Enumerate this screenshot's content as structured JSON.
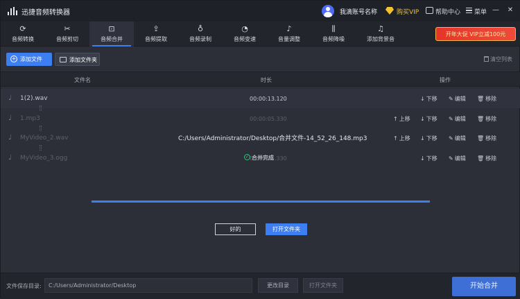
{
  "app": {
    "title": "迅捷音频转换器"
  },
  "titlebar": {
    "account": "我滴账号名称",
    "vip": "购买VIP",
    "messages": "帮助中心",
    "menu": "菜单",
    "minimize": "—",
    "close": "✕"
  },
  "toolbar": {
    "tools": [
      {
        "label": "音频转换",
        "icon": "refresh-icon"
      },
      {
        "label": "音频剪切",
        "icon": "scissors-icon"
      },
      {
        "label": "音频合并",
        "icon": "merge-icon"
      },
      {
        "label": "音频提取",
        "icon": "extract-icon"
      },
      {
        "label": "音频录制",
        "icon": "microphone-icon"
      },
      {
        "label": "音频变速",
        "icon": "speed-icon"
      },
      {
        "label": "音量调整",
        "icon": "volume-icon"
      },
      {
        "label": "音频降噪",
        "icon": "noise-reduce-icon"
      },
      {
        "label": "添加背景音",
        "icon": "music-icon"
      }
    ],
    "active_index": 2,
    "promo": "开年大促 VIP立减100元"
  },
  "actions": {
    "add_file": "添加文件",
    "add_folder": "添加文件夹",
    "clear_list": "清空列表"
  },
  "table": {
    "headers": {
      "name": "文件名",
      "duration": "时长",
      "ops": "操作"
    },
    "rows": [
      {
        "name": "1(2).wav",
        "duration": "00:00:13.120",
        "up": "",
        "down": "下移",
        "edit": "编辑",
        "remove": "移除"
      },
      {
        "name": "1.mp3",
        "duration": "00:00:05.330",
        "up": "上移",
        "down": "下移",
        "edit": "编辑",
        "remove": "移除"
      },
      {
        "name": "MyVideo_2.wav",
        "duration": "",
        "up": "上移",
        "down": "下移",
        "edit": "编辑",
        "remove": "移除"
      },
      {
        "name": "MyVideo_3.ogg",
        "duration": "00:00:05.330",
        "up": "",
        "down": "下移",
        "edit": "编辑",
        "remove": "移除"
      }
    ]
  },
  "dialog": {
    "output_path": "C:/Users/Administrator/Desktop/合并文件-14_52_26_148.mp3",
    "status": "合并完成",
    "progress": 1.0,
    "ok": "好的",
    "open_folder": "打开文件夹"
  },
  "footer": {
    "save_label": "文件保存目录:",
    "save_path": "C:/Users/Administrator/Desktop",
    "change_dir": "更改目录",
    "open_folder": "打开文件夹",
    "start": "开始合并"
  },
  "colors": {
    "accent": "#3d7ff0",
    "vip": "#f2c230",
    "promo": "#e6352a",
    "success": "#33c27a"
  }
}
